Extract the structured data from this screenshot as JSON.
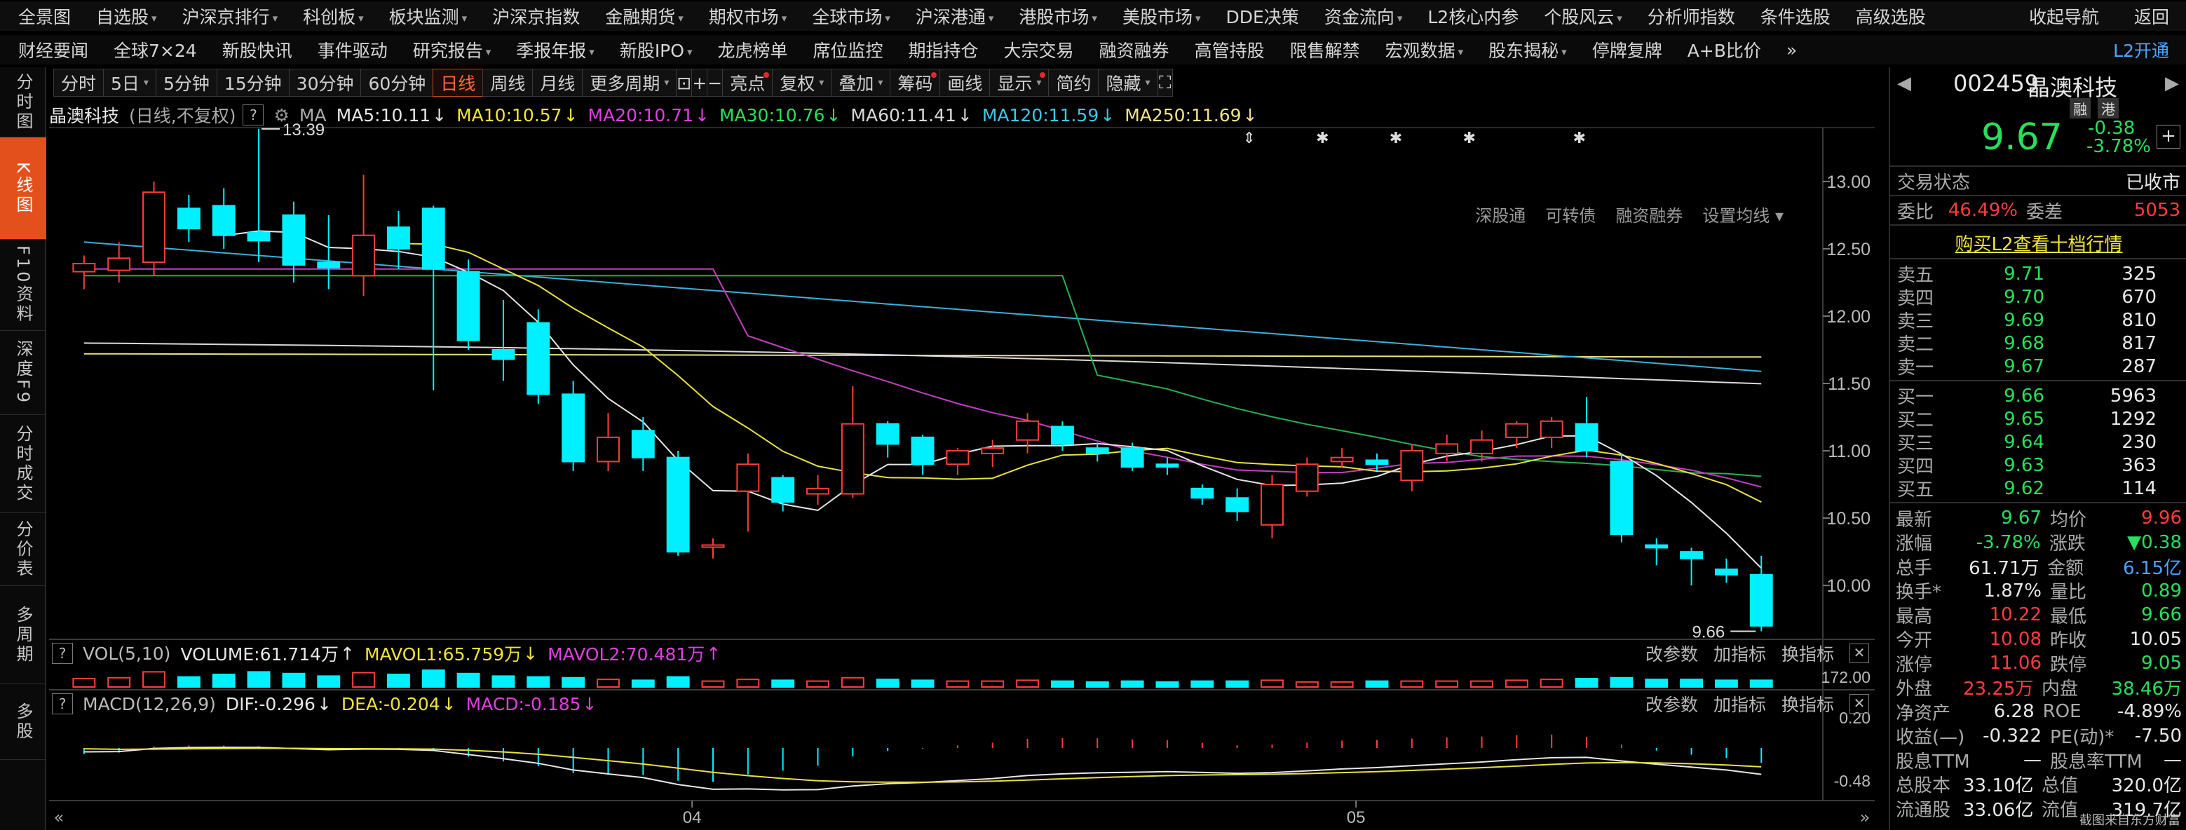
{
  "nav1": [
    "全景图",
    "自选股",
    "沪深京排行",
    "科创板",
    "板块监测",
    "沪深京指数",
    "金融期货",
    "期权市场",
    "全球市场",
    "沪深港通",
    "港股市场",
    "美股市场",
    "DDE决策",
    "资金流向",
    "L2核心内参",
    "个股风云",
    "分析师指数",
    "条件选股",
    "高级选股"
  ],
  "nav1_dd": [
    false,
    true,
    true,
    true,
    true,
    false,
    true,
    true,
    true,
    true,
    true,
    true,
    false,
    true,
    false,
    true,
    false,
    false,
    false
  ],
  "nav1_right": [
    "收起导航",
    "返回"
  ],
  "nav2": [
    "财经要闻",
    "全球7×24",
    "新股快讯",
    "事件驱动",
    "研究报告",
    "季报年报",
    "新股IPO",
    "龙虎榜单",
    "席位监控",
    "期指持仓",
    "大宗交易",
    "融资融券",
    "高管持股",
    "限售解禁",
    "宏观数据",
    "股东揭秘",
    "停牌复牌",
    "A+B比价",
    "»"
  ],
  "nav2_dd": [
    false,
    false,
    false,
    false,
    true,
    true,
    true,
    false,
    false,
    false,
    false,
    false,
    false,
    false,
    true,
    true,
    false,
    false,
    false
  ],
  "nav2_right": [
    "L2开通"
  ],
  "left_tabs": [
    {
      "label": "分时图",
      "active": false
    },
    {
      "label": "K线图",
      "active": true
    },
    {
      "label": "F10资料",
      "active": false
    },
    {
      "label": "深度F9",
      "active": false
    },
    {
      "label": "分时成交",
      "active": false
    },
    {
      "label": "分价表",
      "active": false
    },
    {
      "label": "多周期",
      "active": false
    },
    {
      "label": "多股",
      "active": false
    }
  ],
  "period_buttons": [
    {
      "label": "分时",
      "active": false,
      "dd": false
    },
    {
      "label": "5日",
      "active": false,
      "dd": true
    },
    {
      "label": "5分钟",
      "active": false,
      "dd": false
    },
    {
      "label": "15分钟",
      "active": false,
      "dd": false
    },
    {
      "label": "30分钟",
      "active": false,
      "dd": false
    },
    {
      "label": "60分钟",
      "active": false,
      "dd": false
    },
    {
      "label": "日线",
      "active": true,
      "dd": false
    },
    {
      "label": "周线",
      "active": false,
      "dd": false
    },
    {
      "label": "月线",
      "active": false,
      "dd": false
    },
    {
      "label": "更多周期",
      "active": false,
      "dd": true
    }
  ],
  "tool_buttons": [
    {
      "label": "⊡",
      "icon": "export-icon"
    },
    {
      "label": "+",
      "icon": "zoom-in-icon"
    },
    {
      "label": "−",
      "icon": "zoom-out-icon"
    },
    {
      "label": "亮点",
      "dot": true
    },
    {
      "label": "复权",
      "dd": true
    },
    {
      "label": "叠加",
      "dd": true
    },
    {
      "label": "筹码",
      "dot": true
    },
    {
      "label": "画线"
    },
    {
      "label": "显示",
      "dd": true,
      "dot": true
    },
    {
      "label": "简约"
    },
    {
      "label": "隐藏",
      "dd": true
    },
    {
      "label": "⛶",
      "icon": "fullscreen-icon"
    }
  ],
  "ma_legend": {
    "name": "晶澳科技",
    "mode": "(日线,不复权)",
    "ma": "MA",
    "items": [
      {
        "text": "MA5:10.11",
        "arrow": "↓",
        "color": "#e6e6e6"
      },
      {
        "text": "MA10:10.57",
        "arrow": "↓",
        "color": "#f2e33b"
      },
      {
        "text": "MA20:10.71",
        "arrow": "↓",
        "color": "#e040e0"
      },
      {
        "text": "MA30:10.76",
        "arrow": "↓",
        "color": "#28e05a"
      },
      {
        "text": "MA60:11.41",
        "arrow": "↓",
        "color": "#d8d8d8"
      },
      {
        "text": "MA120:11.59",
        "arrow": "↓",
        "color": "#3bc9e8"
      },
      {
        "text": "MA250:11.69",
        "arrow": "↓",
        "color": "#f2e38a"
      }
    ]
  },
  "mini_tools": [
    "深股通",
    "可转债",
    "融资融券",
    "设置均线"
  ],
  "vol_legend": {
    "title": "VOL(5,10)",
    "items": [
      {
        "text": "VOLUME:61.714万",
        "arrow": "↑",
        "color": "#e6e6e6"
      },
      {
        "text": "MAVOL1:65.759万",
        "arrow": "↓",
        "color": "#f2e33b"
      },
      {
        "text": "MAVOL2:70.481万",
        "arrow": "↑",
        "color": "#e040e0"
      }
    ]
  },
  "macd_legend": {
    "title": "MACD(12,26,9)",
    "items": [
      {
        "text": "DIF:-0.296",
        "arrow": "↓",
        "color": "#e6e6e6"
      },
      {
        "text": "DEA:-0.204",
        "arrow": "↓",
        "color": "#f2e33b"
      },
      {
        "text": "MACD:-0.185",
        "arrow": "↓",
        "color": "#e040e0"
      }
    ]
  },
  "sub_tools": [
    "改参数",
    "加指标",
    "换指标"
  ],
  "colors": {
    "up": "#ff3c3c",
    "down": "#00f0ff",
    "ma5": "#e6e6e6",
    "ma10": "#e8e040",
    "ma20": "#c040c0",
    "ma30": "#28b050",
    "ma60": "#d8d8d8",
    "ma120": "#3bb0d8",
    "ma250": "#e8e080"
  },
  "chart_data": {
    "type": "candlestick",
    "ylim": [
      9.6,
      13.4
    ],
    "y_ticks": [
      "13.00",
      "12.50",
      "12.00",
      "11.50",
      "11.00",
      "10.50",
      "10.00"
    ],
    "x_labels": [
      "04",
      "05"
    ],
    "high_marker": "13.39",
    "low_marker": "9.66",
    "vol_axis": "172.00",
    "macd_axis": [
      "0.20",
      "-0.48"
    ],
    "candles": [
      [
        12.33,
        12.39,
        12.2,
        12.45
      ],
      [
        12.34,
        12.43,
        12.25,
        12.55
      ],
      [
        12.4,
        12.92,
        12.3,
        13.0
      ],
      [
        12.8,
        12.65,
        12.55,
        12.9
      ],
      [
        12.82,
        12.6,
        12.5,
        12.95
      ],
      [
        12.62,
        12.56,
        12.4,
        13.39
      ],
      [
        12.75,
        12.38,
        12.25,
        12.85
      ],
      [
        12.4,
        12.36,
        12.2,
        12.75
      ],
      [
        12.3,
        12.6,
        12.15,
        13.05
      ],
      [
        12.66,
        12.5,
        12.35,
        12.78
      ],
      [
        12.8,
        12.35,
        11.45,
        12.82
      ],
      [
        12.33,
        11.82,
        11.75,
        12.42
      ],
      [
        11.75,
        11.68,
        11.52,
        12.12
      ],
      [
        11.95,
        11.42,
        11.35,
        12.05
      ],
      [
        11.42,
        10.92,
        10.85,
        11.52
      ],
      [
        10.92,
        11.1,
        10.85,
        11.28
      ],
      [
        11.15,
        10.95,
        10.85,
        11.25
      ],
      [
        10.95,
        10.25,
        10.22,
        11.0
      ],
      [
        10.3,
        10.3,
        10.2,
        10.35
      ],
      [
        10.7,
        10.9,
        10.4,
        10.98
      ],
      [
        10.8,
        10.62,
        10.55,
        10.82
      ],
      [
        10.68,
        10.72,
        10.6,
        10.82
      ],
      [
        10.68,
        11.2,
        10.65,
        11.48
      ],
      [
        11.2,
        11.05,
        10.95,
        11.22
      ],
      [
        11.1,
        10.9,
        10.82,
        11.12
      ],
      [
        10.9,
        11.0,
        10.82,
        11.02
      ],
      [
        10.98,
        11.02,
        10.88,
        11.08
      ],
      [
        11.08,
        11.22,
        10.98,
        11.28
      ],
      [
        11.18,
        11.05,
        11.0,
        11.22
      ],
      [
        11.02,
        10.98,
        10.92,
        11.06
      ],
      [
        11.02,
        10.88,
        10.85,
        11.06
      ],
      [
        10.9,
        10.88,
        10.82,
        10.95
      ],
      [
        10.72,
        10.65,
        10.6,
        10.75
      ],
      [
        10.65,
        10.55,
        10.48,
        10.72
      ],
      [
        10.45,
        10.75,
        10.35,
        10.82
      ],
      [
        10.7,
        10.9,
        10.66,
        10.95
      ],
      [
        10.92,
        10.95,
        10.88,
        11.02
      ],
      [
        10.93,
        10.9,
        10.85,
        10.98
      ],
      [
        10.78,
        11.0,
        10.7,
        11.05
      ],
      [
        10.98,
        11.05,
        10.92,
        11.12
      ],
      [
        10.98,
        11.08,
        10.92,
        11.15
      ],
      [
        11.1,
        11.2,
        11.02,
        11.22
      ],
      [
        11.1,
        11.22,
        11.02,
        11.25
      ],
      [
        11.2,
        11.0,
        10.95,
        11.4
      ],
      [
        10.92,
        10.38,
        10.32,
        10.98
      ],
      [
        10.3,
        10.28,
        10.15,
        10.35
      ],
      [
        10.25,
        10.2,
        10.0,
        10.28
      ],
      [
        10.12,
        10.08,
        10.02,
        10.2
      ],
      [
        10.08,
        9.7,
        9.66,
        10.22
      ]
    ],
    "volumes": [
      0.5,
      0.55,
      0.9,
      0.6,
      0.75,
      0.9,
      0.8,
      0.65,
      0.85,
      0.75,
      1.0,
      0.8,
      0.65,
      0.6,
      0.55,
      0.45,
      0.4,
      0.6,
      0.35,
      0.45,
      0.4,
      0.35,
      0.55,
      0.45,
      0.4,
      0.35,
      0.35,
      0.4,
      0.35,
      0.3,
      0.35,
      0.3,
      0.35,
      0.35,
      0.4,
      0.3,
      0.3,
      0.35,
      0.35,
      0.35,
      0.35,
      0.4,
      0.45,
      0.5,
      0.55,
      0.45,
      0.45,
      0.4,
      0.4
    ]
  },
  "quote": {
    "code": "002459",
    "name": "晶澳科技",
    "tags": [
      "融",
      "港"
    ],
    "price": "9.67",
    "chg": "-0.38",
    "pct": "-3.78%",
    "add": "+",
    "status_label": "交易状态",
    "status": "已收市",
    "weibi_label": "委比",
    "weibi": "46.49%",
    "weicha_label": "委差",
    "weicha": "5053",
    "l2_link": "购买L2查看十档行情",
    "asks": [
      [
        "卖五",
        "9.71",
        "325"
      ],
      [
        "卖四",
        "9.70",
        "670"
      ],
      [
        "卖三",
        "9.69",
        "810"
      ],
      [
        "卖二",
        "9.68",
        "817"
      ],
      [
        "卖一",
        "9.67",
        "287"
      ]
    ],
    "bids": [
      [
        "买一",
        "9.66",
        "5963"
      ],
      [
        "买二",
        "9.65",
        "1292"
      ],
      [
        "买三",
        "9.64",
        "230"
      ],
      [
        "买四",
        "9.63",
        "363"
      ],
      [
        "买五",
        "9.62",
        "114"
      ]
    ],
    "stats": [
      [
        "最新",
        "9.67",
        "c-green",
        "均价",
        "9.96",
        "c-red"
      ],
      [
        "涨幅",
        "-3.78%",
        "c-green",
        "涨跌",
        "▼0.38",
        "c-green"
      ],
      [
        "总手",
        "61.71万",
        "c-white",
        "金额",
        "6.15亿",
        "c-blue"
      ],
      [
        "换手*",
        "1.87%",
        "c-white",
        "量比",
        "0.89",
        "c-green"
      ],
      [
        "最高",
        "10.22",
        "c-red",
        "最低",
        "9.66",
        "c-green"
      ],
      [
        "今开",
        "10.08",
        "c-red",
        "昨收",
        "10.05",
        "c-white"
      ],
      [
        "涨停",
        "11.06",
        "c-red",
        "跌停",
        "9.05",
        "c-green"
      ],
      [
        "外盘",
        "23.25万",
        "c-red",
        "内盘",
        "38.46万",
        "c-green"
      ],
      [
        "净资产",
        "6.28",
        "c-white",
        "ROE",
        "-4.89%",
        "c-white"
      ],
      [
        "收益(—)",
        "-0.322",
        "c-white",
        "PE(动)*",
        "-7.50",
        "c-white"
      ],
      [
        "股息TTM",
        "—",
        "c-white",
        "股息率TTM",
        "—",
        "c-white"
      ],
      [
        "总股本",
        "33.10亿",
        "c-white",
        "总值",
        "320.0亿",
        "c-white"
      ],
      [
        "流通股",
        "33.06亿",
        "c-white",
        "流值",
        "319.7亿",
        "c-white"
      ]
    ],
    "footer": "截图来自东方财富"
  }
}
